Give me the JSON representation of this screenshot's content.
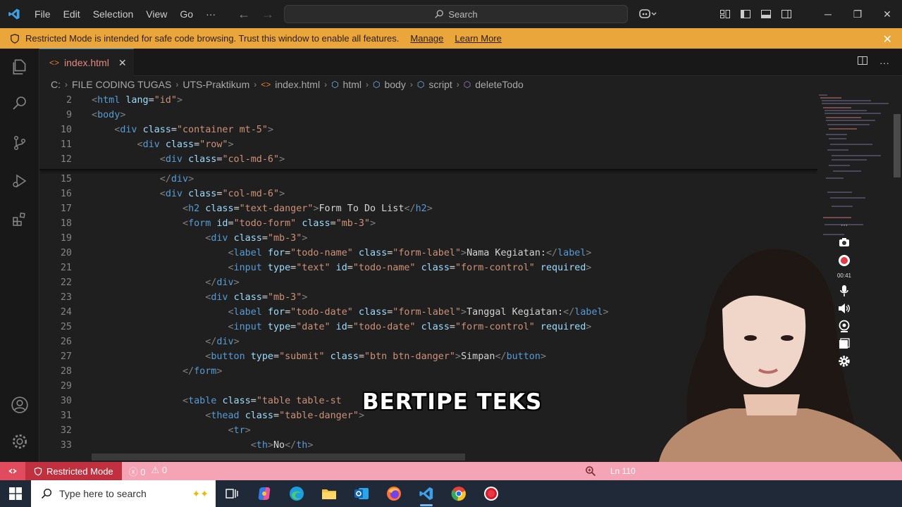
{
  "titlebar": {
    "menus": [
      "File",
      "Edit",
      "Selection",
      "View",
      "Go",
      "···"
    ],
    "search_label": "Search"
  },
  "banner": {
    "message": "Restricted Mode is intended for safe code browsing. Trust this window to enable all features.",
    "manage": "Manage",
    "learn_more": "Learn More"
  },
  "tab": {
    "label": "index.html",
    "close": "✕"
  },
  "breadcrumb": [
    "C:",
    "FILE CODING TUGAS",
    "UTS-Praktikum",
    "index.html",
    "html",
    "body",
    "script",
    "deleteTodo"
  ],
  "code": {
    "line_numbers": [
      "2",
      "9",
      "10",
      "11",
      "12",
      "15",
      "16",
      "17",
      "18",
      "19",
      "20",
      "21",
      "22",
      "23",
      "24",
      "25",
      "26",
      "27",
      "28",
      "29",
      "30",
      "31",
      "32",
      "33"
    ]
  },
  "caption": "BERTIPE TEKS",
  "recorder": {
    "time": "00:41"
  },
  "statusbar": {
    "restricted": "Restricted Mode",
    "errors": "0",
    "warnings": "0",
    "position": "Ln 110"
  },
  "taskbar": {
    "search_placeholder": "Type here to search"
  },
  "colors": {
    "banner": "#eaa63a",
    "statusbar": "#f4a4b4",
    "restricted": "#c0303f",
    "editor_bg": "#1f1f1f",
    "tag": "#569cd6",
    "attr": "#9cdcfe",
    "string": "#ce9178"
  }
}
